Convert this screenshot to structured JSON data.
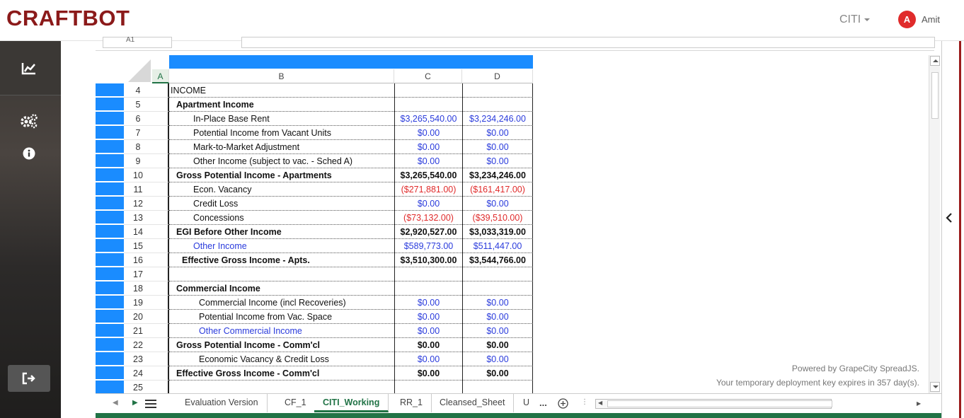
{
  "header": {
    "logo": "CRAFTBOT",
    "tenant": "CITI",
    "avatar_initial": "A",
    "user_name": "Amit"
  },
  "sidebar": {
    "items": [
      {
        "icon": "chart-line-icon"
      },
      {
        "icon": "gears-icon"
      },
      {
        "icon": "info-circle-icon"
      },
      {
        "icon": "sign-out-icon"
      }
    ]
  },
  "formula_bar": {
    "cell_ref": "A1"
  },
  "columns": [
    "A",
    "B",
    "C",
    "D"
  ],
  "rows": [
    {
      "num": "4",
      "b": "INCOME",
      "b_style": "black",
      "b_indent": 2,
      "b_bold": false,
      "c": "",
      "d": "",
      "cd_style": "black"
    },
    {
      "num": "5",
      "b": "Apartment Income",
      "b_style": "black",
      "b_indent": 10,
      "b_bold": true,
      "c": "",
      "d": "",
      "cd_style": "black"
    },
    {
      "num": "6",
      "b": "In-Place Base Rent",
      "b_style": "black",
      "b_indent": 34,
      "b_bold": false,
      "c": "$3,265,540.00",
      "d": "$3,234,246.00",
      "cd_style": "blue"
    },
    {
      "num": "7",
      "b": "Potential Income from Vacant Units",
      "b_style": "black",
      "b_indent": 34,
      "b_bold": false,
      "c": "$0.00",
      "d": "$0.00",
      "cd_style": "blue"
    },
    {
      "num": "8",
      "b": "Mark-to-Market Adjustment",
      "b_style": "black",
      "b_indent": 34,
      "b_bold": false,
      "c": "$0.00",
      "d": "$0.00",
      "cd_style": "blue"
    },
    {
      "num": "9",
      "b": "Other Income (subject to vac. - Sched A)",
      "b_style": "black",
      "b_indent": 34,
      "b_bold": false,
      "c": "$0.00",
      "d": "$0.00",
      "cd_style": "blue"
    },
    {
      "num": "10",
      "b": "Gross Potential Income - Apartments",
      "b_style": "black",
      "b_indent": 10,
      "b_bold": true,
      "c": "$3,265,540.00",
      "d": "$3,234,246.00",
      "cd_style": "black bold"
    },
    {
      "num": "11",
      "b": "Econ. Vacancy",
      "b_style": "black",
      "b_indent": 34,
      "b_bold": false,
      "c": "($271,881.00)",
      "d": "($161,417.00)",
      "cd_style": "red"
    },
    {
      "num": "12",
      "b": "Credit Loss",
      "b_style": "black",
      "b_indent": 34,
      "b_bold": false,
      "c": "$0.00",
      "d": "$0.00",
      "cd_style": "blue"
    },
    {
      "num": "13",
      "b": "Concessions",
      "b_style": "black",
      "b_indent": 34,
      "b_bold": false,
      "c": "($73,132.00)",
      "d": "($39,510.00)",
      "cd_style": "red"
    },
    {
      "num": "14",
      "b": "EGI Before Other Income",
      "b_style": "black",
      "b_indent": 10,
      "b_bold": true,
      "c": "$2,920,527.00",
      "d": "$3,033,319.00",
      "cd_style": "black bold"
    },
    {
      "num": "15",
      "b": "Other Income",
      "b_style": "blue",
      "b_indent": 34,
      "b_bold": false,
      "c": "$589,773.00",
      "d": "$511,447.00",
      "cd_style": "blue"
    },
    {
      "num": "16",
      "b": "Effective Gross Income - Apts.",
      "b_style": "black",
      "b_indent": 18,
      "b_bold": true,
      "c": "$3,510,300.00",
      "d": "$3,544,766.00",
      "cd_style": "black bold"
    },
    {
      "num": "17",
      "b": "",
      "b_style": "black",
      "b_indent": 10,
      "b_bold": false,
      "c": "",
      "d": "",
      "cd_style": "black"
    },
    {
      "num": "18",
      "b": "Commercial Income",
      "b_style": "black",
      "b_indent": 10,
      "b_bold": true,
      "c": "",
      "d": "",
      "cd_style": "black"
    },
    {
      "num": "19",
      "b": "Commercial Income (incl Recoveries)",
      "b_style": "black",
      "b_indent": 42,
      "b_bold": false,
      "c": "$0.00",
      "d": "$0.00",
      "cd_style": "blue"
    },
    {
      "num": "20",
      "b": "Potential Income from Vac. Space",
      "b_style": "black",
      "b_indent": 42,
      "b_bold": false,
      "c": "$0.00",
      "d": "$0.00",
      "cd_style": "blue"
    },
    {
      "num": "21",
      "b": "Other Commercial Income",
      "b_style": "blue",
      "b_indent": 42,
      "b_bold": false,
      "c": "$0.00",
      "d": "$0.00",
      "cd_style": "blue"
    },
    {
      "num": "22",
      "b": "Gross Potential Income - Comm'cl",
      "b_style": "black",
      "b_indent": 10,
      "b_bold": true,
      "c": "$0.00",
      "d": "$0.00",
      "cd_style": "black bold"
    },
    {
      "num": "23",
      "b": "Economic Vacancy & Credit Loss",
      "b_style": "black",
      "b_indent": 42,
      "b_bold": false,
      "c": "$0.00",
      "d": "$0.00",
      "cd_style": "blue"
    },
    {
      "num": "24",
      "b": "Effective Gross Income - Comm'cl",
      "b_style": "black",
      "b_indent": 10,
      "b_bold": true,
      "c": "$0.00",
      "d": "$0.00",
      "cd_style": "black bold"
    },
    {
      "num": "25",
      "b": "",
      "b_style": "black",
      "b_indent": 10,
      "b_bold": false,
      "c": "",
      "d": "",
      "cd_style": "black"
    }
  ],
  "watermark": {
    "line1": "Powered by GrapeCity SpreadJS.",
    "line2": "Your temporary deployment key expires in 357 day(s)."
  },
  "tabs": {
    "items": [
      {
        "label": "Evaluation Version",
        "active": false
      },
      {
        "label": "CF_1",
        "active": false
      },
      {
        "label": "CITI_Working",
        "active": true
      },
      {
        "label": "RR_1",
        "active": false
      },
      {
        "label": "Cleansed_Sheet",
        "active": false
      },
      {
        "label": "U",
        "active": false
      }
    ],
    "more": "...",
    "add": "+"
  },
  "colors": {
    "brand": "#8b1a1a",
    "selection_blue": "#1a8cff",
    "value_blue": "#2a3bdc",
    "negative_red": "#e02b2b",
    "sheet_green": "#217346"
  }
}
